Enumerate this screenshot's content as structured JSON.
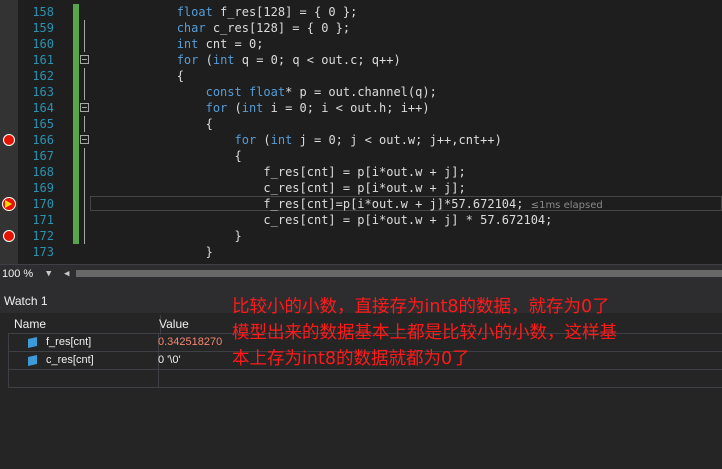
{
  "editor": {
    "lines": [
      {
        "num": "158",
        "parts": [
          {
            "t": "            "
          },
          {
            "t": "float",
            "k": 1
          },
          {
            "t": " f_res[128] = { 0 };"
          }
        ]
      },
      {
        "num": "159",
        "parts": [
          {
            "t": "            "
          },
          {
            "t": "char",
            "k": 1
          },
          {
            "t": " c_res[128] = { 0 };"
          }
        ]
      },
      {
        "num": "160",
        "parts": [
          {
            "t": "            "
          },
          {
            "t": "int",
            "k": 1
          },
          {
            "t": " cnt = 0;"
          }
        ]
      },
      {
        "num": "161",
        "parts": [
          {
            "t": "            "
          },
          {
            "t": "for",
            "k": 1
          },
          {
            "t": " ("
          },
          {
            "t": "int",
            "k": 1
          },
          {
            "t": " q = 0; q < out.c; q++)"
          }
        ]
      },
      {
        "num": "162",
        "parts": [
          {
            "t": "            {"
          }
        ]
      },
      {
        "num": "163",
        "parts": [
          {
            "t": "                "
          },
          {
            "t": "const",
            "k": 1
          },
          {
            "t": " "
          },
          {
            "t": "float",
            "k": 1
          },
          {
            "t": "* p = out.channel(q);"
          }
        ]
      },
      {
        "num": "164",
        "parts": [
          {
            "t": "                "
          },
          {
            "t": "for",
            "k": 1
          },
          {
            "t": " ("
          },
          {
            "t": "int",
            "k": 1
          },
          {
            "t": " i = 0; i < out.h; i++)"
          }
        ]
      },
      {
        "num": "165",
        "parts": [
          {
            "t": "                {"
          }
        ]
      },
      {
        "num": "166",
        "parts": [
          {
            "t": "                    "
          },
          {
            "t": "for",
            "k": 1
          },
          {
            "t": " ("
          },
          {
            "t": "int",
            "k": 1
          },
          {
            "t": " j = 0; j < out.w; j++,cnt++)"
          }
        ]
      },
      {
        "num": "167",
        "parts": [
          {
            "t": "                    {"
          }
        ]
      },
      {
        "num": "168",
        "parts": [
          {
            "t": "                        f_res[cnt] = p[i*out.w + j];"
          }
        ]
      },
      {
        "num": "169",
        "parts": [
          {
            "t": "                        c_res[cnt] = p[i*out.w + j];"
          }
        ]
      },
      {
        "num": "170",
        "parts": [
          {
            "t": "                        f_res[cnt]=p[i*out.w + j]*57.672104; "
          }
        ]
      },
      {
        "num": "171",
        "parts": [
          {
            "t": "                        c_res[cnt] = p[i*out.w + j] * 57.672104;"
          }
        ]
      },
      {
        "num": "172",
        "parts": [
          {
            "t": "                    }"
          }
        ]
      },
      {
        "num": "173",
        "parts": [
          {
            "t": "                }"
          }
        ]
      }
    ],
    "elapsed": "≤1ms elapsed",
    "accent_keyword": "#569cd6",
    "accent_linenum": "#2b91af"
  },
  "statusbar": {
    "zoom": "100 %"
  },
  "watch": {
    "title": "Watch 1",
    "col_name": "Name",
    "col_value": "Value",
    "rows": [
      {
        "name": "f_res[cnt]",
        "value": "0.342518270",
        "changed": true
      },
      {
        "name": "c_res[cnt]",
        "value": "0 '\\0'",
        "changed": false
      }
    ]
  },
  "annotation": {
    "lines": [
      "比较小的小数，直接存为int8的数据，就存为0了",
      "模型出来的数据基本上都是比较小的小数，这样基",
      "本上存为int8的数据就都为0了"
    ],
    "color": "#ff1a1a"
  }
}
